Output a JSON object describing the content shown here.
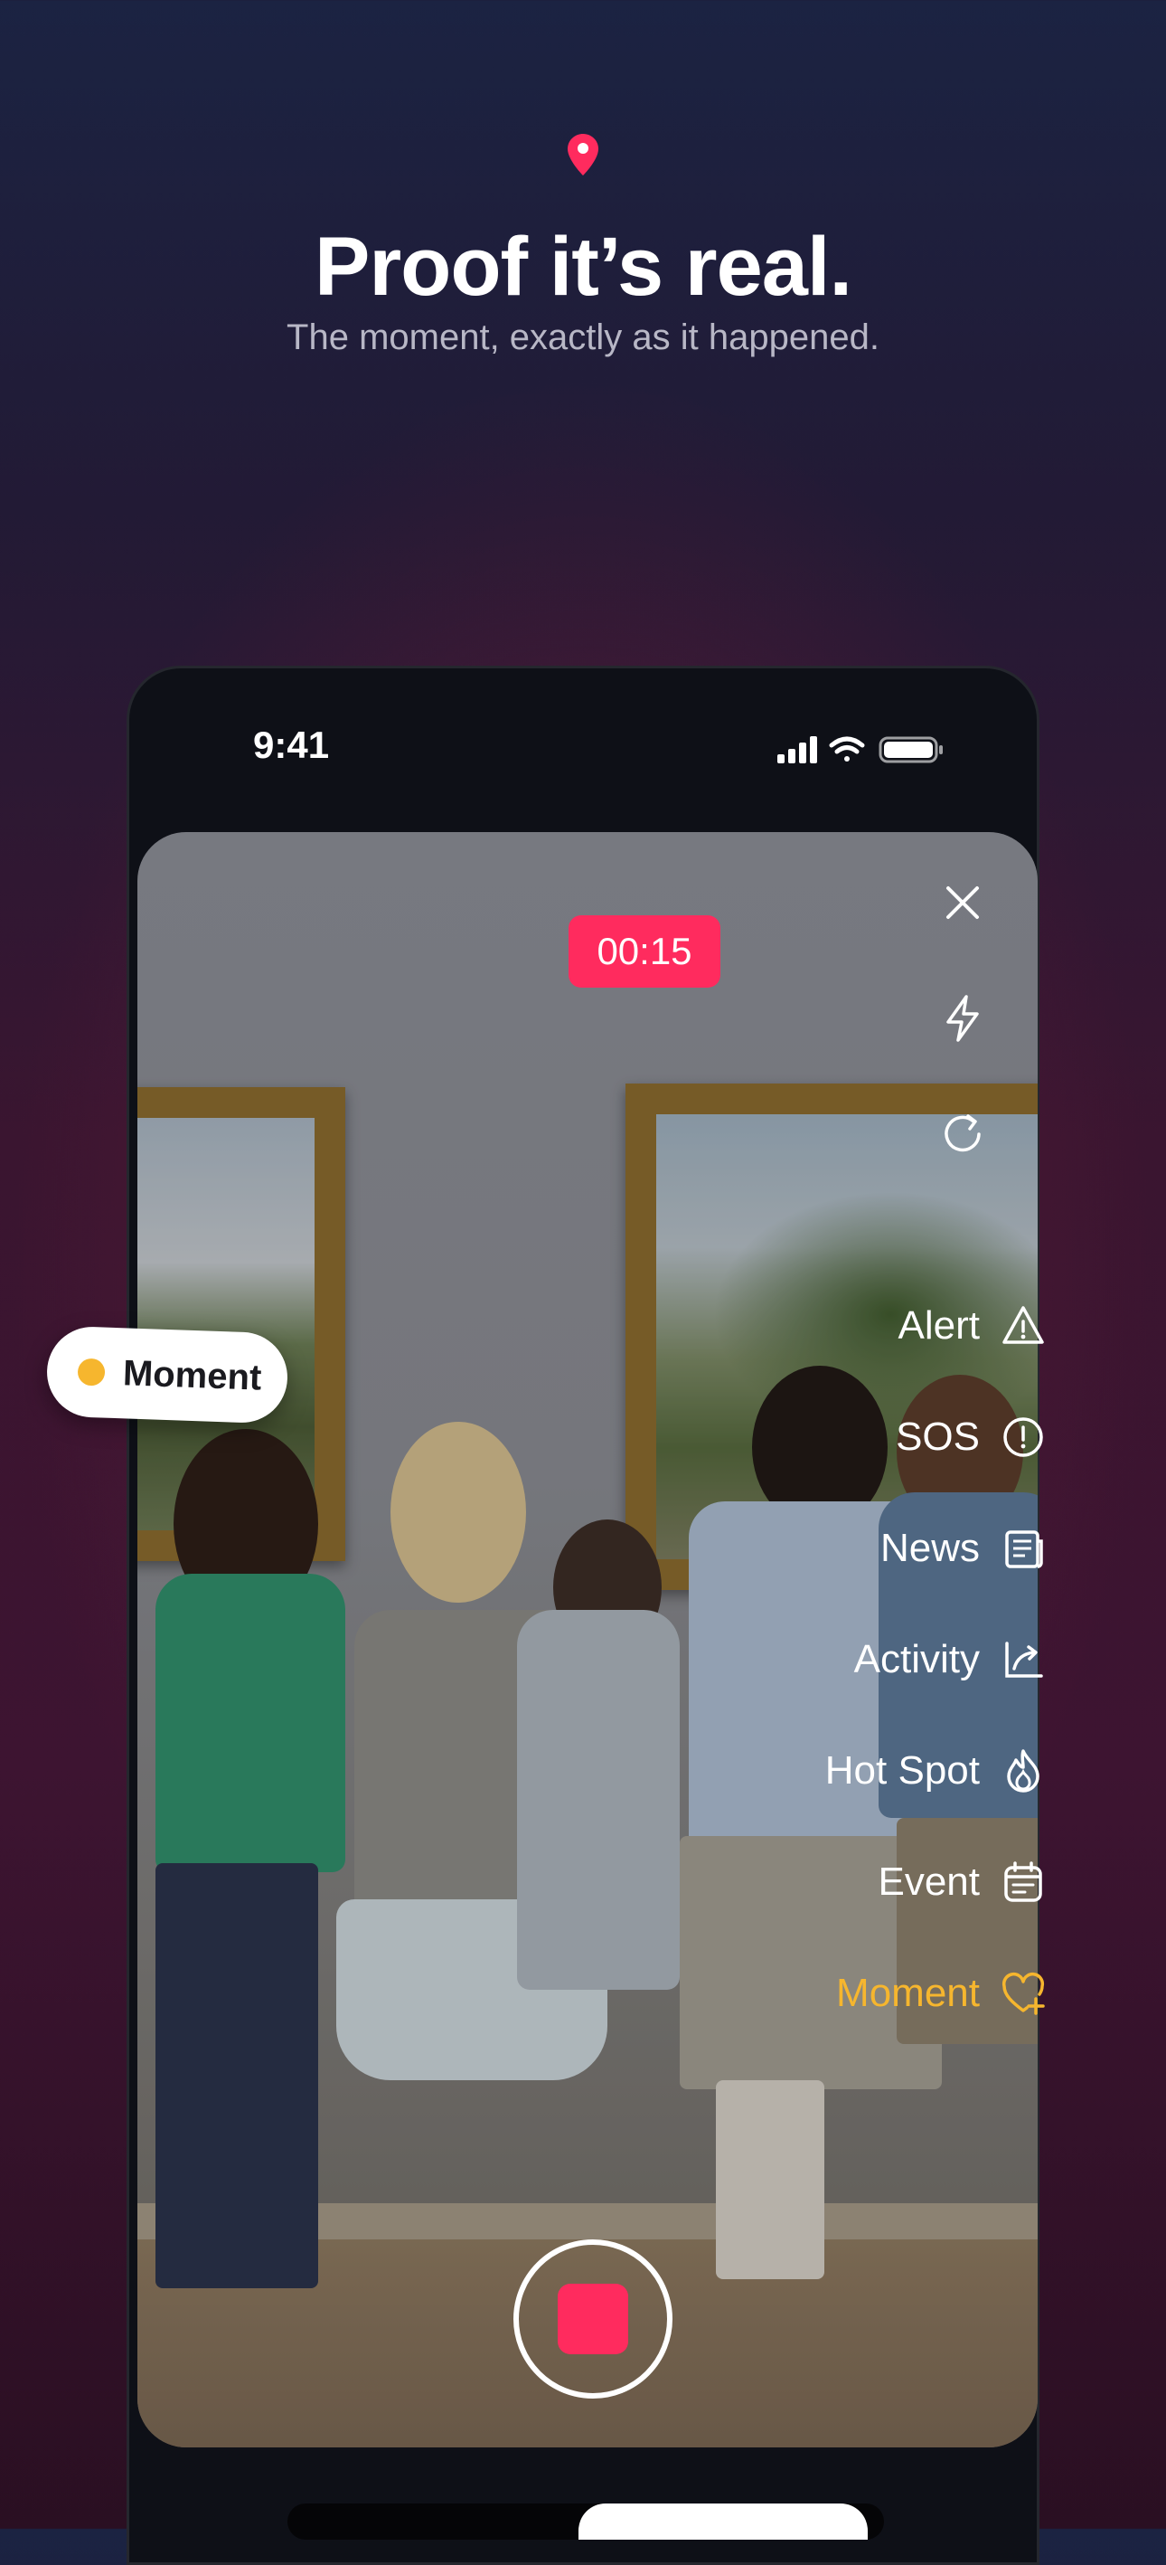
{
  "marketing": {
    "headline": "Proof it’s real.",
    "subline": "The moment, exactly as it happened."
  },
  "status_bar": {
    "time": "9:41"
  },
  "camera": {
    "timer": "00:15"
  },
  "side_menu": {
    "items": [
      {
        "label": "Alert",
        "icon": "alert-triangle-icon"
      },
      {
        "label": "SOS",
        "icon": "exclamation-circle-icon"
      },
      {
        "label": "News",
        "icon": "newspaper-icon"
      },
      {
        "label": "Activity",
        "icon": "chart-arrow-icon"
      },
      {
        "label": "Hot Spot",
        "icon": "flame-icon"
      },
      {
        "label": "Event",
        "icon": "calendar-icon"
      },
      {
        "label": "Moment",
        "icon": "heart-plus-icon",
        "active": true
      }
    ]
  },
  "moment_tag": {
    "label": "Moment"
  },
  "colors": {
    "accent": "#ff2b5e",
    "active": "#f6b62e"
  }
}
